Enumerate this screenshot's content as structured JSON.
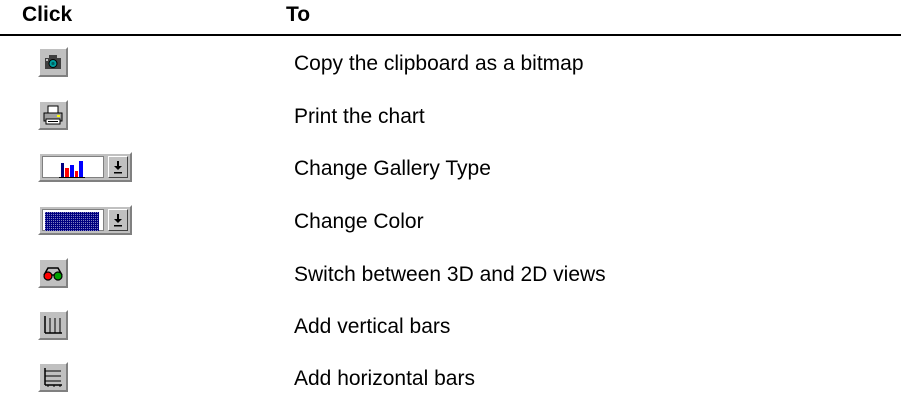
{
  "header": {
    "col_click": "Click",
    "col_to": "To"
  },
  "rows": [
    {
      "icon": "camera-icon",
      "description": "Copy the clipboard as a bitmap"
    },
    {
      "icon": "printer-icon",
      "description": "Print the chart"
    },
    {
      "icon": "gallery-type-icon",
      "description": "Change Gallery Type"
    },
    {
      "icon": "color-palette-icon",
      "description": "Change Color"
    },
    {
      "icon": "3d-glasses-icon",
      "description": "Switch between 3D and 2D views"
    },
    {
      "icon": "vertical-grid-icon",
      "description": "Add vertical bars"
    },
    {
      "icon": "horizontal-grid-icon",
      "description": "Add horizontal bars"
    }
  ],
  "colors": {
    "button_face": "#c0c0c0",
    "bar_red": "#ff0000",
    "bar_blue": "#0000ff",
    "swatch_navy": "#000080"
  }
}
